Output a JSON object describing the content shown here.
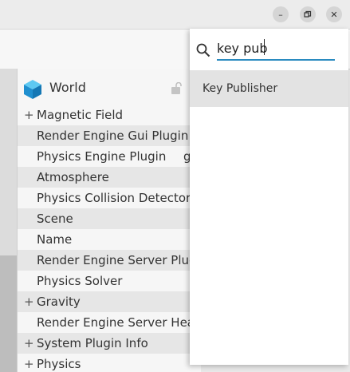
{
  "window": {
    "minimize_icon": "minimize-icon",
    "restore_icon": "restore-icon",
    "close_icon": "close-icon",
    "minimize_glyph": "–",
    "close_glyph": "✕"
  },
  "tree": {
    "root_label": "World",
    "root_icon": "cube-icon",
    "lock_icon": "lock-icon",
    "items": [
      {
        "label": "Magnetic Field",
        "expandable": "+"
      },
      {
        "label": "Render Engine Gui Plugin",
        "expandable": ""
      },
      {
        "label": "Physics Engine Plugin",
        "expandable": ""
      },
      {
        "label": "Atmosphere",
        "expandable": ""
      },
      {
        "label": "Physics Collision Detector",
        "expandable": ""
      },
      {
        "label": "Scene",
        "expandable": ""
      },
      {
        "label": "Name",
        "expandable": ""
      },
      {
        "label": "Render Engine Server Plug",
        "expandable": ""
      },
      {
        "label": "Physics Solver",
        "expandable": ""
      },
      {
        "label": "Gravity",
        "expandable": "+"
      },
      {
        "label": "Render Engine Server Head",
        "expandable": ""
      },
      {
        "label": "System Plugin Info",
        "expandable": "+"
      },
      {
        "label": "Physics",
        "expandable": "+"
      }
    ],
    "stray_text": "g"
  },
  "search": {
    "value": "key pub",
    "icon": "search-icon",
    "accent_color": "#2a8bc0"
  },
  "results": [
    {
      "label": "Key Publisher"
    }
  ]
}
